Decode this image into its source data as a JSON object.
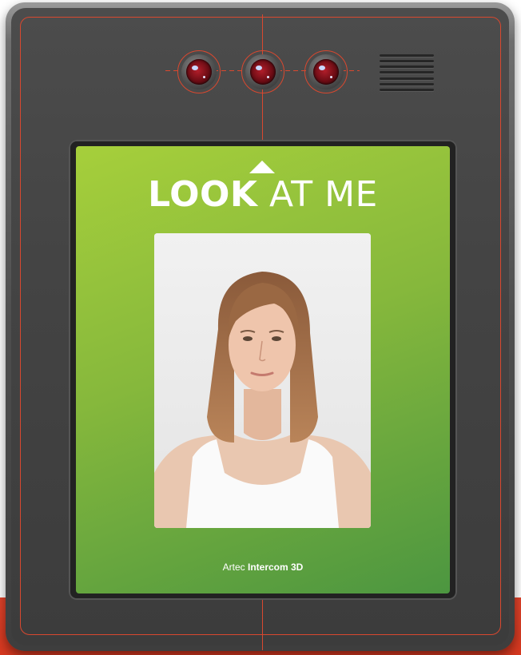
{
  "screen": {
    "headline_bold": "LOOK",
    "headline_light": "AT ME",
    "brand_prefix": "Artec",
    "brand_product": "Intercom 3D"
  },
  "icons": {
    "arrow": "arrow-up-icon",
    "cameras": [
      "camera-lens-icon",
      "camera-lens-icon",
      "camera-lens-icon"
    ],
    "speaker": "speaker-grille-icon"
  },
  "colors": {
    "screen_gradient_start": "#a6cf3b",
    "screen_gradient_end": "#4c9640",
    "accent_line": "#d9482f",
    "device_body": "#444444",
    "accent_band": "#e2432b"
  }
}
